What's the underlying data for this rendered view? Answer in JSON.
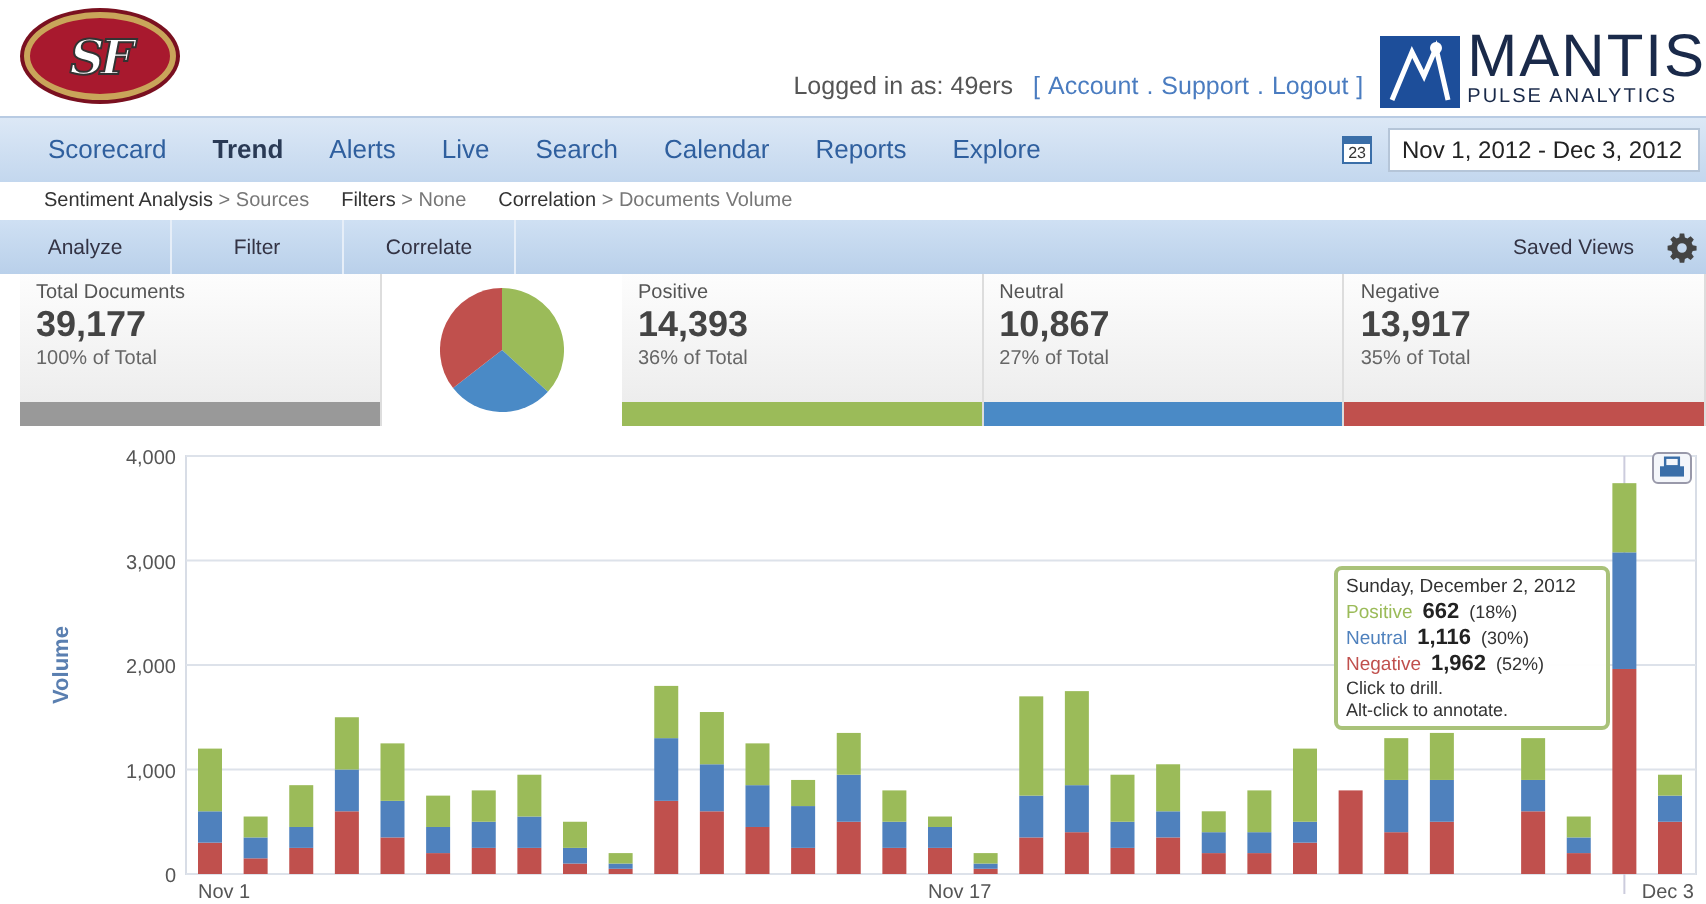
{
  "header": {
    "team_logo_text": "SF",
    "login_label": "Logged in as: 49ers",
    "bracket_open": "[",
    "links": [
      "Account",
      "Support",
      "Logout"
    ],
    "link_separator": ".",
    "bracket_close": "]",
    "brand_name": "MANTIS",
    "brand_tagline": "PULSE ANALYTICS"
  },
  "nav": {
    "items": [
      {
        "label": "Scorecard",
        "selected": false
      },
      {
        "label": "Trend",
        "selected": true
      },
      {
        "label": "Alerts",
        "selected": false
      },
      {
        "label": "Live",
        "selected": false
      },
      {
        "label": "Search",
        "selected": false
      },
      {
        "label": "Calendar",
        "selected": false
      },
      {
        "label": "Reports",
        "selected": false
      },
      {
        "label": "Explore",
        "selected": false
      }
    ],
    "calendar_day": "23",
    "date_range": "Nov 1, 2012 - Dec 3, 2012"
  },
  "breadcrumbs": [
    {
      "label": "Sentiment Analysis",
      "separator": ">",
      "value": "Sources"
    },
    {
      "label": "Filters",
      "separator": ">",
      "value": "None"
    },
    {
      "label": "Correlation",
      "separator": ">",
      "value": "Documents Volume"
    }
  ],
  "toolbar": {
    "buttons": [
      "Analyze",
      "Filter",
      "Correlate"
    ],
    "saved_views": "Saved Views"
  },
  "stats": [
    {
      "label": "Total Documents",
      "value": "39,177",
      "share": "100% of Total",
      "color": "#999999"
    },
    {
      "label": "Positive",
      "value": "14,393",
      "share": "36% of Total",
      "color": "#9bbb59"
    },
    {
      "label": "Neutral",
      "value": "10,867",
      "share": "27% of Total",
      "color": "#4a8ac6"
    },
    {
      "label": "Negative",
      "value": "13,917",
      "share": "35% of Total",
      "color": "#c0504d"
    }
  ],
  "chart": {
    "chart_data": {
      "type": "bar",
      "stacked": true,
      "grid": true,
      "ylabel": "Volume",
      "ylim": [
        0,
        4000
      ],
      "yticks": [
        {
          "value": 0,
          "label": "0"
        },
        {
          "value": 1000,
          "label": "1,000"
        },
        {
          "value": 2000,
          "label": "2,000"
        },
        {
          "value": 3000,
          "label": "3,000"
        },
        {
          "value": 4000,
          "label": "4,000"
        }
      ],
      "categories": [
        "Nov 1",
        null,
        null,
        null,
        null,
        null,
        null,
        null,
        null,
        null,
        null,
        null,
        null,
        null,
        null,
        null,
        "Nov 17",
        null,
        null,
        null,
        null,
        null,
        null,
        null,
        null,
        null,
        null,
        null,
        null,
        null,
        null,
        null,
        "Dec 3"
      ],
      "series": [
        {
          "name": "Negative",
          "color": "#c0504d",
          "values": [
            300,
            150,
            250,
            600,
            350,
            200,
            250,
            250,
            100,
            50,
            700,
            600,
            450,
            250,
            500,
            250,
            250,
            50,
            350,
            400,
            250,
            350,
            200,
            200,
            300,
            800,
            400,
            500,
            null,
            600,
            200,
            1962,
            500
          ]
        },
        {
          "name": "Neutral",
          "color": "#4f81bd",
          "values": [
            300,
            200,
            200,
            400,
            350,
            250,
            250,
            300,
            150,
            50,
            600,
            450,
            400,
            400,
            450,
            250,
            200,
            50,
            400,
            450,
            250,
            250,
            200,
            200,
            200,
            null,
            500,
            400,
            null,
            300,
            150,
            1116,
            250
          ]
        },
        {
          "name": "Positive",
          "color": "#9bbb59",
          "values": [
            600,
            200,
            400,
            500,
            550,
            300,
            300,
            400,
            250,
            100,
            500,
            500,
            400,
            250,
            400,
            300,
            100,
            100,
            950,
            900,
            450,
            450,
            200,
            400,
            700,
            null,
            400,
            450,
            null,
            400,
            200,
            662,
            200
          ]
        }
      ]
    },
    "tooltip": {
      "title": "Sunday, December 2, 2012",
      "rows": [
        {
          "value": "662",
          "share": "(18%)"
        },
        {
          "value": "1,116",
          "share": "(30%)"
        },
        {
          "value": "1,962",
          "share": "(52%)"
        }
      ],
      "hints": [
        "Click to drill.",
        "Alt-click to annotate."
      ]
    }
  }
}
